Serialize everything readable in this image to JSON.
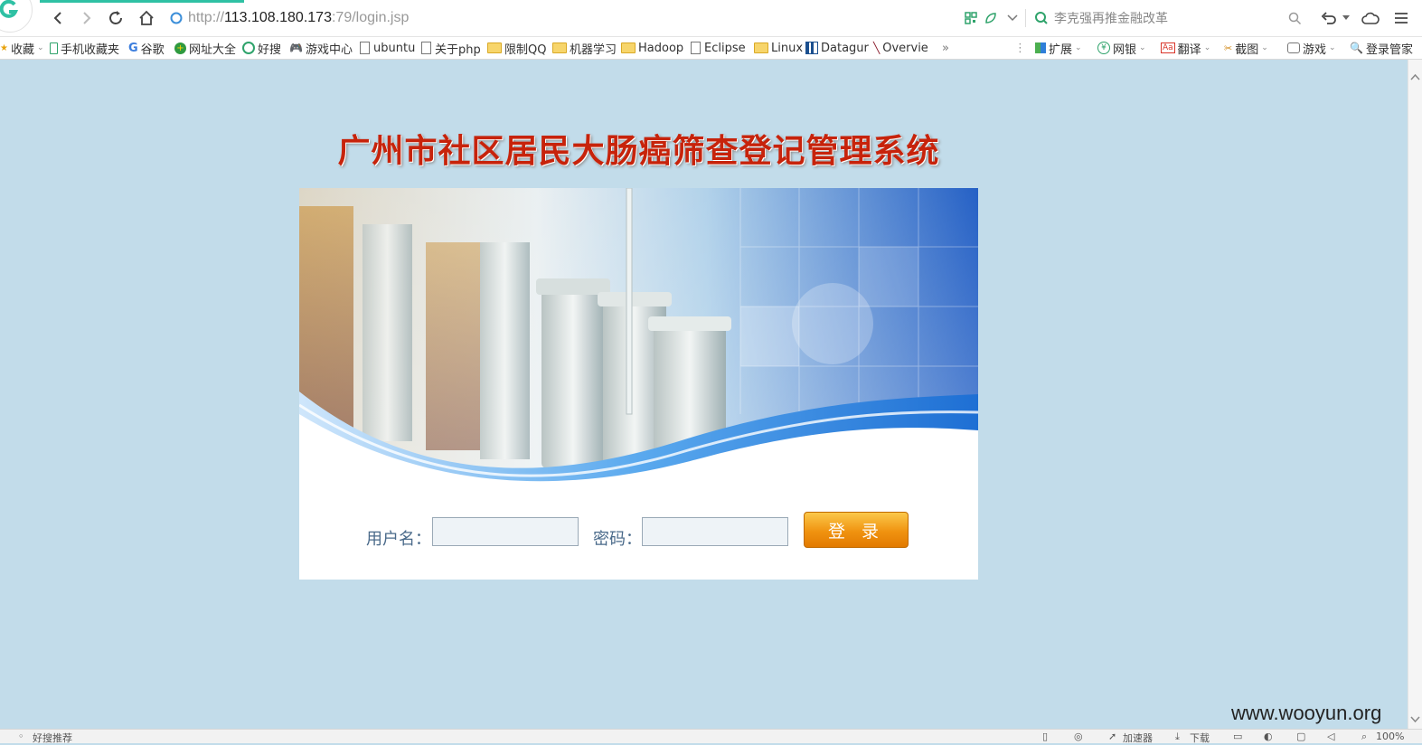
{
  "browser": {
    "url_protocol": "http://",
    "url_host": "113.108.180.173",
    "url_path": ":79/login.jsp",
    "search_text": "李克强再推金融改革",
    "accent": "#2fc1a4"
  },
  "bookmarks": {
    "collect": "收藏",
    "items": [
      "手机收藏夹",
      "谷歌",
      "网址大全",
      "好搜",
      "游戏中心",
      "ubuntu",
      "关于php",
      "限制QQ",
      "机器学习",
      "Hadoop",
      "Eclipse",
      "Linux",
      "Datagur",
      "Overvie"
    ],
    "more": "»",
    "right_items": [
      "扩展",
      "网银",
      "翻译",
      "截图",
      "游戏",
      "登录管家"
    ]
  },
  "status": {
    "left": "好搜推荐",
    "accelerator": "加速器",
    "download": "下载",
    "zoom": "100%"
  },
  "page": {
    "title": "广州市社区居民大肠癌筛查登记管理系统",
    "username_label": "用户名：",
    "password_label": "密码：",
    "login_button": "登 录",
    "background": "#c2dcea"
  },
  "watermark": "www.wooyun.org"
}
